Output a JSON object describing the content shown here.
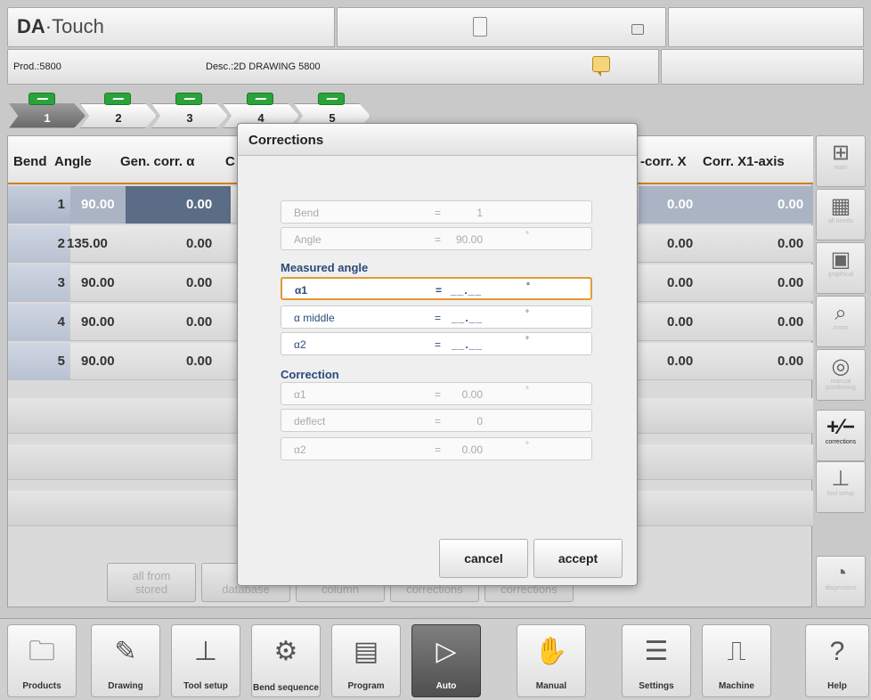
{
  "header": {
    "brand_bold": "DA",
    "brand_rest": "·Touch",
    "prod": "Prod.:5800",
    "desc": "Desc.:2D DRAWING 5800",
    "icons": [
      "calculator-icon",
      "padlock-icon",
      "note-icon"
    ]
  },
  "tabs": [
    {
      "label": "1",
      "active": true
    },
    {
      "label": "2"
    },
    {
      "label": "3"
    },
    {
      "label": "4"
    },
    {
      "label": "5"
    }
  ],
  "table": {
    "headers": [
      "Bend",
      "Angle",
      "Gen. corr. α",
      "C",
      "-corr. X",
      "Corr. X1-axis"
    ],
    "rows": [
      {
        "bend": "1",
        "angle": "90.00",
        "gen": "0.00",
        "corrx": "0.00",
        "x1": "0.00"
      },
      {
        "bend": "2",
        "angle": "135.00",
        "gen": "0.00",
        "corrx": "0.00",
        "x1": "0.00"
      },
      {
        "bend": "3",
        "angle": "90.00",
        "gen": "0.00",
        "corrx": "0.00",
        "x1": "0.00"
      },
      {
        "bend": "4",
        "angle": "90.00",
        "gen": "0.00",
        "corrx": "0.00",
        "x1": "0.00"
      },
      {
        "bend": "5",
        "angle": "90.00",
        "gen": "0.00",
        "corrx": "0.00",
        "x1": "0.00"
      }
    ]
  },
  "bottom_buttons": [
    {
      "l1": "all from",
      "l2": "stored"
    },
    {
      "l1": "",
      "l2": "database"
    },
    {
      "l1": "",
      "l2": "column"
    },
    {
      "l1": "",
      "l2": "corrections"
    },
    {
      "l1": "",
      "l2": "corrections"
    }
  ],
  "sidebar": [
    {
      "icon": "main-view-icon",
      "glyph": "⊞",
      "label": "main"
    },
    {
      "icon": "all-bends-icon",
      "glyph": "▦",
      "label": "all bends"
    },
    {
      "icon": "graphical-icon",
      "glyph": "▣",
      "label": "graphical"
    },
    {
      "icon": "magnifier-icon",
      "glyph": "⌕",
      "label": "zoom"
    },
    {
      "icon": "manual-positioning-icon",
      "glyph": "◎",
      "label": "manual positioning"
    },
    {
      "icon": "plus-minus-icon",
      "glyph": "+∕−",
      "label": "corrections"
    },
    {
      "icon": "tool-setup-icon",
      "glyph": "⊥",
      "label": "tool setup"
    },
    {
      "icon": "diagnostics-icon",
      "glyph": "◔",
      "label": "diagnostics"
    }
  ],
  "dialog": {
    "title": "Corrections",
    "info": [
      {
        "label": "Bend",
        "eq": "=",
        "value": "1",
        "unit": ""
      },
      {
        "label": "Angle",
        "eq": "=",
        "value": "90.00",
        "unit": "°"
      }
    ],
    "measured_title": "Measured angle",
    "measured": [
      {
        "label": "α1",
        "eq": "=",
        "value": "__.__",
        "unit": "°"
      },
      {
        "label": "α middle",
        "eq": "=",
        "value": "__.__",
        "unit": "°"
      },
      {
        "label": "α2",
        "eq": "=",
        "value": "__.__",
        "unit": "°"
      }
    ],
    "correction_title": "Correction",
    "correction": [
      {
        "label": "α1",
        "eq": "=",
        "value": "0.00",
        "unit": "°"
      },
      {
        "label": "deflect",
        "eq": "=",
        "value": "0",
        "unit": ""
      },
      {
        "label": "α2",
        "eq": "=",
        "value": "0.00",
        "unit": "°"
      }
    ],
    "cancel": "cancel",
    "accept": "accept"
  },
  "nav": [
    {
      "label": "Products",
      "glyph": "🗀",
      "icon": "folder-icon"
    },
    {
      "label": "Drawing",
      "glyph": "✎",
      "icon": "pencil-icon"
    },
    {
      "label": "Tool setup",
      "glyph": "⊥",
      "icon": "tool-setup-icon"
    },
    {
      "label": "Bend sequence",
      "glyph": "⚙",
      "icon": "bend-sequence-icon"
    },
    {
      "label": "Program",
      "glyph": "▤",
      "icon": "program-icon"
    },
    {
      "label": "Auto",
      "glyph": "▷",
      "icon": "play-icon",
      "active": true
    },
    {
      "label": "Manual",
      "glyph": "✋",
      "icon": "hand-icon"
    },
    {
      "label": "Settings",
      "glyph": "☰",
      "icon": "settings-icon"
    },
    {
      "label": "Machine",
      "glyph": "⎍",
      "icon": "machine-icon"
    },
    {
      "label": "Help",
      "glyph": "?",
      "icon": "help-icon"
    }
  ]
}
